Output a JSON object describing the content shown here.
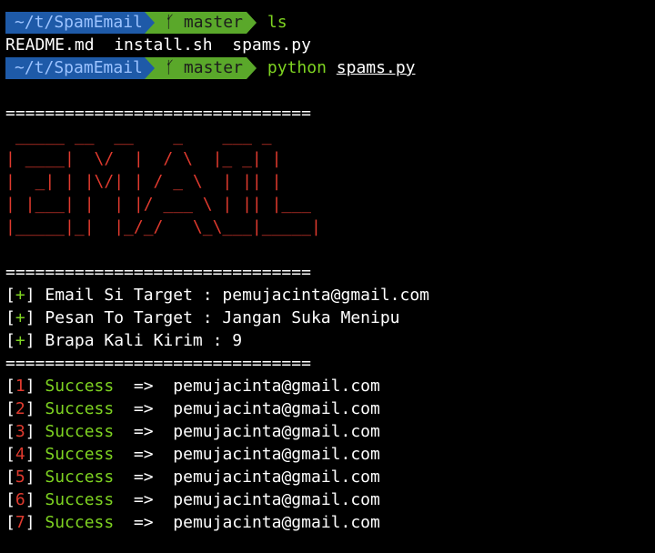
{
  "prompt": {
    "dir": "~/t/SpamEmail",
    "branch_icon": "git-branch-icon",
    "branch": "master"
  },
  "commands": {
    "first": "ls",
    "second_program": "python",
    "second_arg": "spams.py"
  },
  "ls_output": "README.md  install.sh  spams.py",
  "separator": "===============================",
  "ascii_banner": [
    " _____ __  __    _    ___ _",
    "| ____|  \\/  |  / \\  |_ _| |",
    "|  _| | |\\/| | / _ \\  | || |",
    "| |___| |  | |/ ___ \\ | || |___",
    "|_____|_|  |_/_/   \\_\\___|_____|"
  ],
  "info": [
    {
      "bracket_open": "[",
      "mark": "+",
      "bracket_close": "]",
      "text": " Email Si Target : pemujacinta@gmail.com"
    },
    {
      "bracket_open": "[",
      "mark": "+",
      "bracket_close": "]",
      "text": " Pesan To Target : Jangan Suka Menipu"
    },
    {
      "bracket_open": "[",
      "mark": "+",
      "bracket_close": "]",
      "text": " Brapa Kali Kirim : 9"
    }
  ],
  "results": [
    {
      "n": "1",
      "status": "Success",
      "arrow": "  =>  ",
      "email": "pemujacinta@gmail.com"
    },
    {
      "n": "2",
      "status": "Success",
      "arrow": "  =>  ",
      "email": "pemujacinta@gmail.com"
    },
    {
      "n": "3",
      "status": "Success",
      "arrow": "  =>  ",
      "email": "pemujacinta@gmail.com"
    },
    {
      "n": "4",
      "status": "Success",
      "arrow": "  =>  ",
      "email": "pemujacinta@gmail.com"
    },
    {
      "n": "5",
      "status": "Success",
      "arrow": "  =>  ",
      "email": "pemujacinta@gmail.com"
    },
    {
      "n": "6",
      "status": "Success",
      "arrow": "  =>  ",
      "email": "pemujacinta@gmail.com"
    },
    {
      "n": "7",
      "status": "Success",
      "arrow": "  =>  ",
      "email": "pemujacinta@gmail.com"
    }
  ],
  "colors": {
    "background": "#000000",
    "dir_segment": "#1e5aa8",
    "git_segment": "#5aa82a",
    "banner": "#e03a2e",
    "success": "#7ed321"
  }
}
